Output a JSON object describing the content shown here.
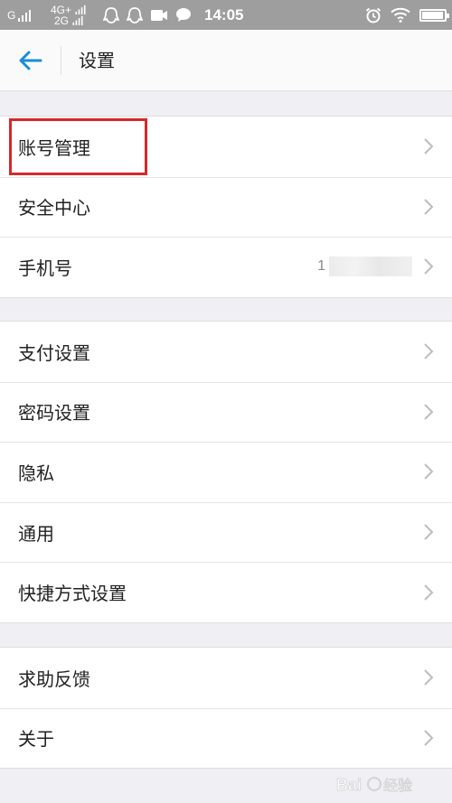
{
  "status_bar": {
    "network1": "G",
    "network2_top": "4G+",
    "network2_bottom": "2G",
    "time": "14:05",
    "battery_level": 0.95,
    "icons": [
      "signal-icon",
      "qq-icon",
      "qq-icon",
      "video-icon",
      "message-icon",
      "alarm-icon",
      "wifi-icon",
      "battery-icon"
    ]
  },
  "header": {
    "back_icon": "arrow-left-icon",
    "title": "设置"
  },
  "groups": [
    {
      "items": [
        {
          "label": "账号管理"
        },
        {
          "label": "安全中心"
        },
        {
          "label": "手机号",
          "value_prefix": "1"
        }
      ]
    },
    {
      "items": [
        {
          "label": "支付设置"
        },
        {
          "label": "密码设置"
        },
        {
          "label": "隐私"
        },
        {
          "label": "通用"
        },
        {
          "label": "快捷方式设置"
        }
      ]
    },
    {
      "items": [
        {
          "label": "求助反馈"
        },
        {
          "label": "关于"
        }
      ]
    }
  ],
  "colors": {
    "accent": "#1a8ed6",
    "highlight": "#d9262c",
    "status_bar": "#9e9e9e",
    "background": "#efeff4"
  }
}
